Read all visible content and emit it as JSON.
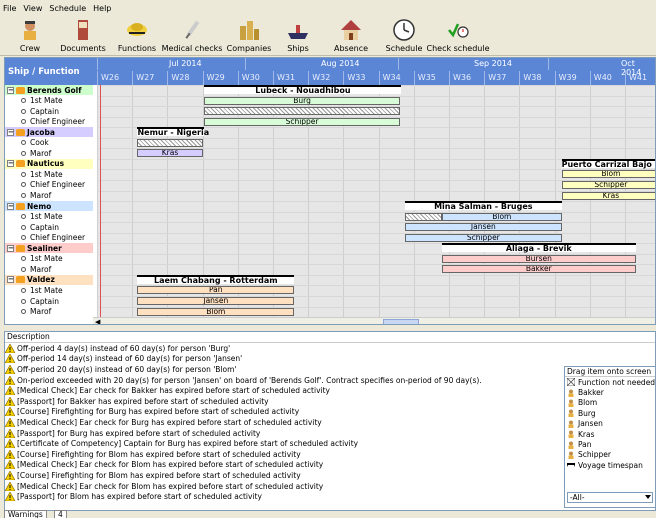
{
  "menu": [
    "File",
    "View",
    "Schedule",
    "Help"
  ],
  "toolbar": [
    "Crew",
    "Documents",
    "Functions",
    "Medical checks",
    "Companies",
    "Ships",
    "Absence",
    "Schedule",
    "Check schedule"
  ],
  "gantt": {
    "header_label": "Ship / Function",
    "months": [
      "Jul 2014",
      "Aug 2014",
      "Sep 2014",
      "Oct 2014"
    ],
    "weeks": [
      "W26",
      "W27",
      "W28",
      "W29",
      "W30",
      "W31",
      "W32",
      "W33",
      "W34",
      "W35",
      "W36",
      "W37",
      "W38",
      "W39",
      "W40",
      "W41"
    ],
    "rows": [
      {
        "label": "Berends Golf",
        "type": "ship",
        "color": "#ccffcc"
      },
      {
        "label": "1st Mate",
        "type": "func"
      },
      {
        "label": "Captain",
        "type": "func"
      },
      {
        "label": "Chief Engineer",
        "type": "func"
      },
      {
        "label": "Jacoba",
        "type": "ship",
        "color": "#d5ccff"
      },
      {
        "label": "Cook",
        "type": "func"
      },
      {
        "label": "Marof",
        "type": "func"
      },
      {
        "label": "Nauticus",
        "type": "ship",
        "color": "#ffffc0"
      },
      {
        "label": "1st Mate",
        "type": "func"
      },
      {
        "label": "Chief Engineer",
        "type": "func"
      },
      {
        "label": "Marof",
        "type": "func"
      },
      {
        "label": "Nemo",
        "type": "ship",
        "color": "#cce4ff"
      },
      {
        "label": "1st Mate",
        "type": "func"
      },
      {
        "label": "Captain",
        "type": "func"
      },
      {
        "label": "Chief Engineer",
        "type": "func"
      },
      {
        "label": "Sealiner",
        "type": "ship",
        "color": "#ffcccc"
      },
      {
        "label": "1st Mate",
        "type": "func"
      },
      {
        "label": "Marof",
        "type": "func"
      },
      {
        "label": "Valdez",
        "type": "ship",
        "color": "#ffe0c0"
      },
      {
        "label": "1st Mate",
        "type": "func"
      },
      {
        "label": "Captain",
        "type": "func"
      },
      {
        "label": "Marof",
        "type": "func"
      }
    ],
    "voyages": [
      {
        "label": "Lubeck - Nouadhibou",
        "row": 0,
        "start": 3.05,
        "end": 8.65
      },
      {
        "label": "Nemur - Nigeria",
        "row": 4,
        "start": 1.15,
        "end": 3.05
      },
      {
        "label": "Puerto Carrizal Bajo - Assab",
        "row": 7,
        "start": 13.2,
        "end": 16.0
      },
      {
        "label": "Mina Salman - Bruges",
        "row": 11,
        "start": 8.75,
        "end": 13.2
      },
      {
        "label": "Aliaga - Brevik",
        "row": 15,
        "start": 9.8,
        "end": 15.3
      },
      {
        "label": "Laem Chabang - Rotterdam",
        "row": 18,
        "start": 1.15,
        "end": 5.6
      }
    ],
    "bars": [
      {
        "label": "Burg",
        "row": 1,
        "start": 3.05,
        "end": 8.6,
        "color": "#d8fcd8"
      },
      {
        "label": "",
        "row": 2,
        "start": 3.05,
        "end": 8.6,
        "color": "hatch"
      },
      {
        "label": "Schipper",
        "row": 3,
        "start": 3.05,
        "end": 8.6,
        "color": "#d8fcd8"
      },
      {
        "label": "",
        "row": 5,
        "start": 1.15,
        "end": 3.0,
        "color": "hatch"
      },
      {
        "label": "Kras",
        "row": 6,
        "start": 1.15,
        "end": 3.0,
        "color": "#d5ccff"
      },
      {
        "label": "Blom",
        "row": 8,
        "start": 13.2,
        "end": 16.0,
        "color": "#ffffc0"
      },
      {
        "label": "Schipper",
        "row": 9,
        "start": 13.2,
        "end": 16.0,
        "color": "#ffffc0"
      },
      {
        "label": "Kras",
        "row": 10,
        "start": 13.2,
        "end": 16.0,
        "color": "#ffffc0"
      },
      {
        "label": "",
        "row": 12,
        "start": 8.75,
        "end": 9.8,
        "color": "hatch"
      },
      {
        "label": "Blom",
        "row": 12,
        "start": 9.8,
        "end": 13.2,
        "color": "#cce4ff"
      },
      {
        "label": "Jansen",
        "row": 13,
        "start": 8.75,
        "end": 13.2,
        "color": "#cce4ff"
      },
      {
        "label": "Schipper",
        "row": 14,
        "start": 8.75,
        "end": 13.2,
        "color": "#cce4ff"
      },
      {
        "label": "Bursen",
        "row": 16,
        "start": 9.8,
        "end": 15.3,
        "color": "#ffcccc"
      },
      {
        "label": "Bakker",
        "row": 17,
        "start": 9.8,
        "end": 15.3,
        "color": "#ffcccc"
      },
      {
        "label": "Pan",
        "row": 19,
        "start": 1.15,
        "end": 5.6,
        "color": "#ffe0c0"
      },
      {
        "label": "Jansen",
        "row": 20,
        "start": 1.15,
        "end": 5.6,
        "color": "#ffe0c0"
      },
      {
        "label": "Blom",
        "row": 21,
        "start": 1.15,
        "end": 5.6,
        "color": "#ffe0c0"
      }
    ]
  },
  "description": {
    "header": "Description",
    "messages": [
      "Off-period 4 day(s) instead of 60 day(s) for person 'Burg'",
      "Off-period 14 day(s) instead of 60 day(s) for person 'Jansen'",
      "Off-period 20 day(s) instead of 60 day(s) for person 'Blom'",
      "On-period exceeded with 20 day(s) for person 'Jansen' on board of 'Berends Golf'. Contract specifies on-period of 90 day(s).",
      "[Medical Check] Ear check for Bakker has expired before start of scheduled activity",
      "[Passport]  for Bakker has expired before start of scheduled activity",
      "[Course] Firefighting for Burg has expired before start of scheduled activity",
      "[Medical Check] Ear check for Burg has expired before start of scheduled activity",
      "[Passport]  for Burg has expired before start of scheduled activity",
      "[Certificate of Competency] Captain for Burg has expired before start of scheduled activity",
      "[Course] Firefighting for Blom has expired before start of scheduled activity",
      "[Medical Check] Ear check for Blom has expired before start of scheduled activity",
      "[Course] Firefighting for Blom has expired before start of scheduled activity",
      "[Medical Check] Ear check for Blom has expired before start of scheduled activity",
      "[Passport]  for Blom has expired before start of scheduled activity"
    ]
  },
  "drag_panel": {
    "header": "Drag item onto screen",
    "items": [
      "Function not needed",
      "Bakker",
      "Blom",
      "Burg",
      "Jansen",
      "Kras",
      "Pan",
      "Schipper",
      "Voyage timespan"
    ],
    "combo": "-All-"
  },
  "tabs": [
    "Warnings",
    "4"
  ]
}
